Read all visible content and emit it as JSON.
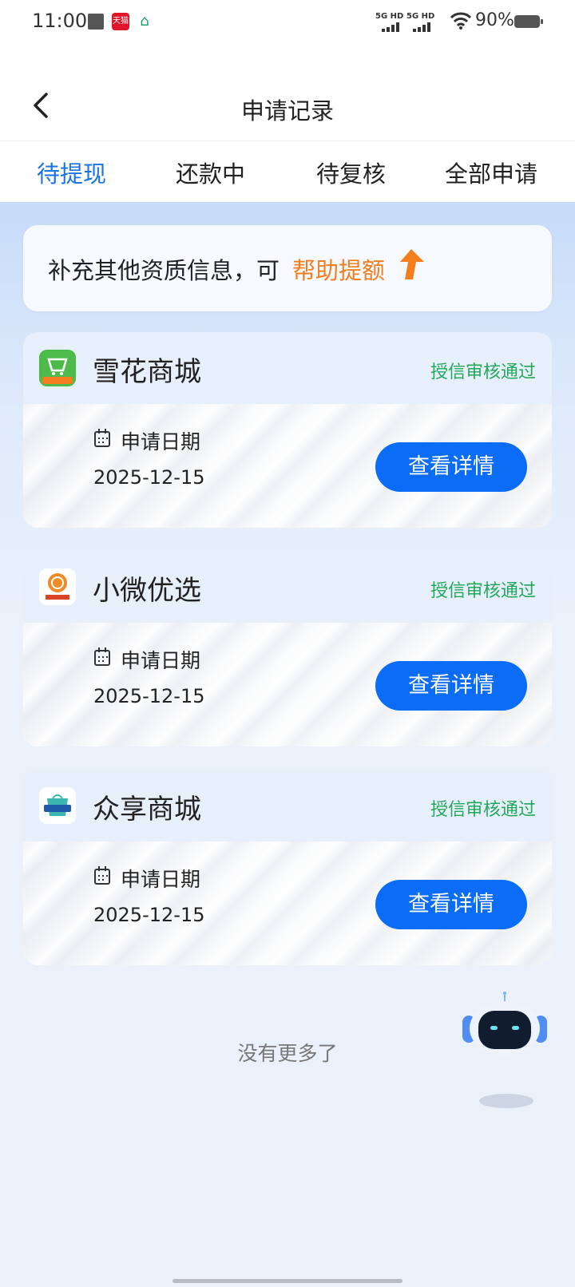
{
  "status_bar": {
    "time": "11:00",
    "net1": "5G HD",
    "net2": "5G HD",
    "battery": "90%"
  },
  "header": {
    "title": "申请记录",
    "back_icon": "chevron-left-icon"
  },
  "tabs": [
    {
      "label": "待提现",
      "active": true
    },
    {
      "label": "还款中",
      "active": false
    },
    {
      "label": "待复核",
      "active": false
    },
    {
      "label": "全部申请",
      "active": false
    }
  ],
  "promo": {
    "text": "补充其他资质信息，可",
    "highlight": "帮助提额",
    "icon": "arrow-up-icon",
    "highlight_color": "#f47d1d"
  },
  "cards": [
    {
      "name": "雪花商城",
      "status": "授信审核通过",
      "date_label": "申请日期",
      "date": "2025-12-15",
      "button": "查看详情",
      "logo_text": "雪花商城"
    },
    {
      "name": "小微优选",
      "status": "授信审核通过",
      "date_label": "申请日期",
      "date": "2025-12-15",
      "button": "查看详情",
      "logo_text": "小微优选"
    },
    {
      "name": "众享商城",
      "status": "授信审核通过",
      "date_label": "申请日期",
      "date": "2025-12-15",
      "button": "查看详情",
      "logo_text": "众享商城"
    }
  ],
  "footer": {
    "no_more": "没有更多了"
  },
  "colors": {
    "accent": "#1a74e8",
    "button": "#0b6cf5",
    "status_green": "#22a85a"
  }
}
